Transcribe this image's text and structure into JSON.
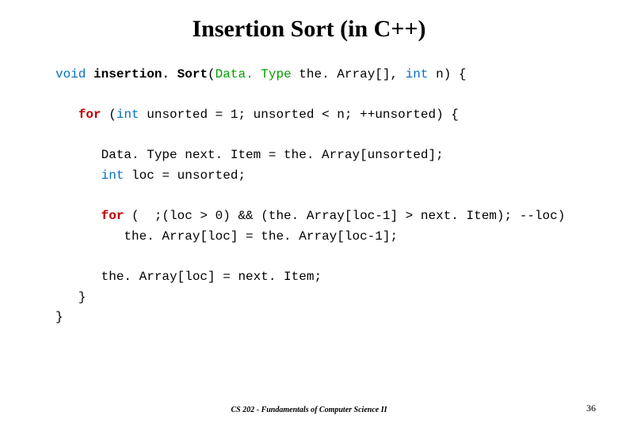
{
  "slide": {
    "title": "Insertion Sort (in C++)",
    "footer_center": "CS 202 - Fundamentals of Computer Science II",
    "page_number": "36"
  },
  "code": {
    "kw_void": "void",
    "fn_name": "insertion. Sort",
    "open_paren": "(",
    "dtype": "Data. Type",
    "sig_rest": " the. Array[], ",
    "kw_int1": "int",
    "sig_tail": " n) {",
    "for1_kw": "for",
    "for1_open": " (",
    "kw_int2": "int",
    "for1_rest": " unsorted = 1; unsorted < n; ++unsorted) {",
    "line_decl1": "Data. Type next. Item = the. Array[unsorted];",
    "kw_int3": "int",
    "line_decl2_rest": " loc = unsorted;",
    "for2_kw": "for",
    "for2_rest": " (  ;(loc > 0) && (the. Array[loc-1] > next. Item); --loc)",
    "line_body": "the. Array[loc] = the. Array[loc-1];",
    "line_assign": "the. Array[loc] = next. Item;",
    "brace_close1": "}",
    "brace_close2": "}"
  }
}
